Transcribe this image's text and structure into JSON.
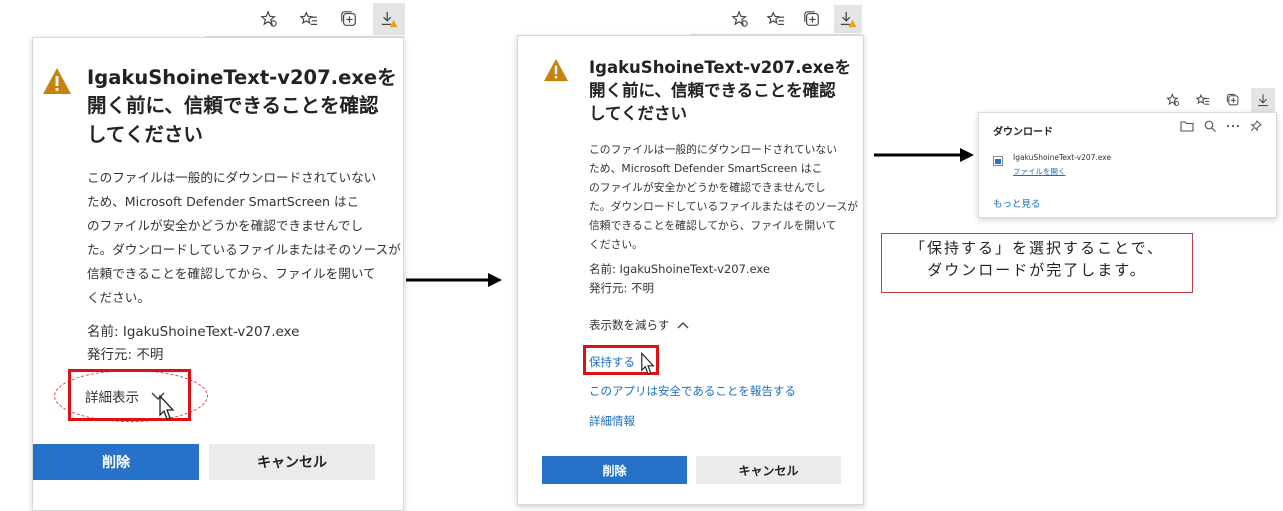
{
  "dialog_left": {
    "title": "IgakuShoineText-v207.exeを\n開く前に、信頼できることを確認\nしてください",
    "body": "このファイルは一般的にダウンロードされていない\nため、Microsoft Defender SmartScreen はこ\nのファイルが安全かどうかを確認できませんでし\nた。ダウンロードしているファイルまたはそのソースが\n信頼できることを確認してから、ファイルを開いて\nください。",
    "name_line": "名前: IgakuShoineText-v207.exe",
    "publisher_line": "発行元: 不明",
    "show_more": "詳細表示",
    "delete_button": "削除",
    "cancel_button": "キャンセル"
  },
  "dialog_right": {
    "title": "IgakuShoineText-v207.exeを\n開く前に、信頼できることを確認\nしてください",
    "body": "このファイルは一般的にダウンロードされていない\nため、Microsoft Defender SmartScreen はこ\nのファイルが安全かどうかを確認できませんでし\nた。ダウンロードしているファイルまたはそのソースが\n信頼できることを確認してから、ファイルを開いて\nください。",
    "name_line": "名前: IgakuShoineText-v207.exe",
    "publisher_line": "発行元: 不明",
    "show_less": "表示数を減らす",
    "keep_link": "保持する",
    "report_link": "このアプリは安全であることを報告する",
    "more_info_link": "詳細情報",
    "delete_button": "削除",
    "cancel_button": "キャンセル"
  },
  "downloads_panel": {
    "title": "ダウンロード",
    "file_name": "IgakuShoineText-v207.exe",
    "open_file_link": "ファイルを開く",
    "more_link": "もっと見る"
  },
  "note": {
    "text": "「保持する」を選択することで、\nダウンロードが完了します。"
  },
  "colors": {
    "accent": "#2672c8",
    "highlight_red": "#e01010",
    "warning": "#c8820a"
  }
}
